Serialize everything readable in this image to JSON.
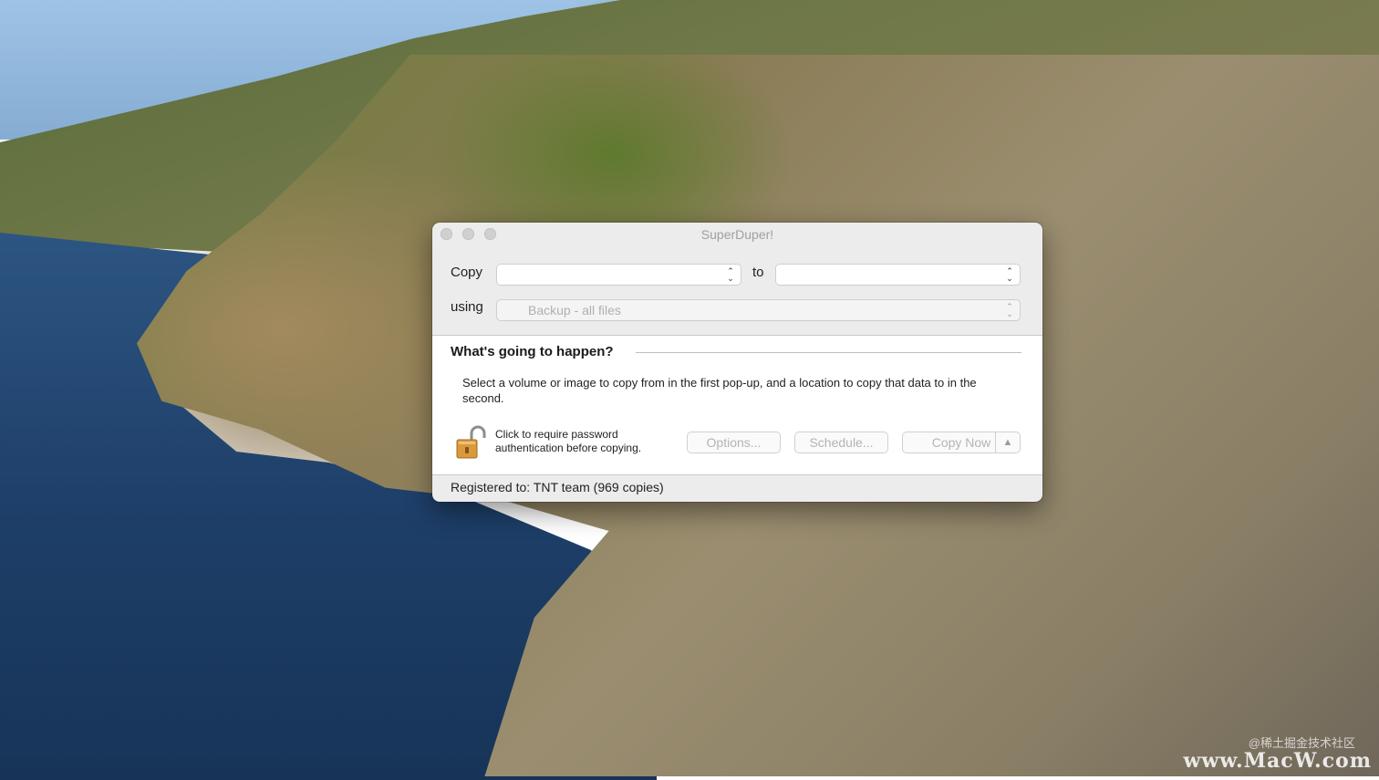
{
  "window": {
    "title": "SuperDuper!"
  },
  "copy_row": {
    "copy_label": "Copy",
    "source_value": "",
    "to_label": "to",
    "destination_value": ""
  },
  "using_row": {
    "using_label": "using",
    "script_value": "Backup - all files"
  },
  "info": {
    "heading": "What's going to happen?",
    "description": "Select a volume or image to copy from in the first pop-up, and a location to copy that data to in the second."
  },
  "lock": {
    "line1": "Click to require password",
    "line2": "authentication before copying."
  },
  "buttons": {
    "options": "Options...",
    "schedule": "Schedule...",
    "copy_now": "Copy Now",
    "copy_now_arrow": "▲"
  },
  "footer": {
    "registration": "Registered to: TNT team (969 copies)"
  },
  "watermark": {
    "subtitle": "@稀土掘金技术社区",
    "brand": "www.MacW.com"
  },
  "icons": {
    "lock": "unlocked-padlock-icon",
    "popup_arrows": "updown-chevron-icon"
  }
}
